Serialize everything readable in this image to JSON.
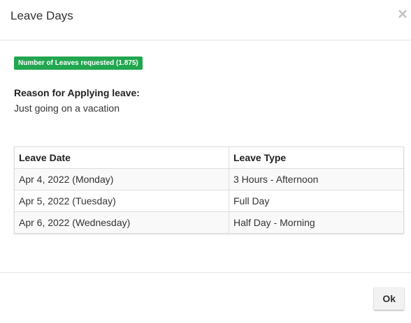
{
  "modal": {
    "title": "Leave Days",
    "close_symbol": "×"
  },
  "badge": {
    "text": "Number of Leaves requested (1.875)",
    "color": "#22a650"
  },
  "reason": {
    "label": "Reason for Applying leave:",
    "text": "Just going on a vacation"
  },
  "table": {
    "headers": [
      "Leave Date",
      "Leave Type"
    ],
    "rows": [
      [
        "Apr 4, 2022 (Monday)",
        "3 Hours - Afternoon"
      ],
      [
        "Apr 5, 2022 (Tuesday)",
        "Full Day"
      ],
      [
        "Apr 6, 2022 (Wednesday)",
        "Half Day - Morning"
      ]
    ]
  },
  "footer": {
    "ok_label": "Ok"
  }
}
